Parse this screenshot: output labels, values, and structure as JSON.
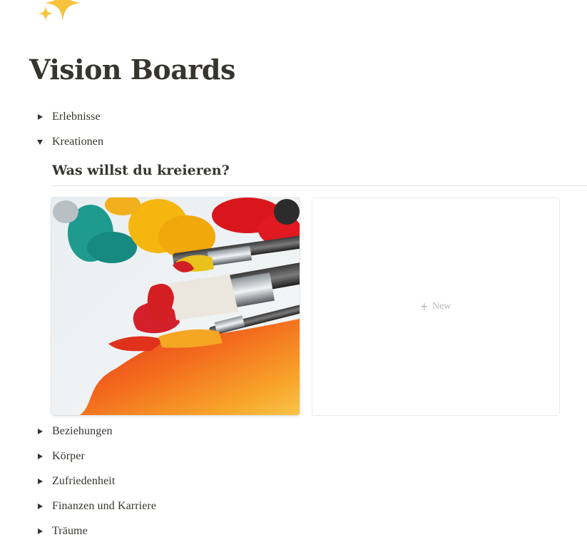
{
  "page": {
    "icon": "sparkles-icon",
    "title": "Vision Boards"
  },
  "toggles_top": [
    {
      "label": "Erlebnisse",
      "expanded": false
    },
    {
      "label": "Kreationen",
      "expanded": true
    }
  ],
  "kreationen": {
    "heading": "Was willst du kreieren?",
    "card_image": "paintbrushes-with-oil-paint",
    "new_label": "New",
    "new_icon": "plus-icon"
  },
  "toggles_bottom": [
    {
      "label": "Beziehungen",
      "expanded": false
    },
    {
      "label": "Körper",
      "expanded": false
    },
    {
      "label": "Zufriedenheit",
      "expanded": false
    },
    {
      "label": "Finanzen und Karriere",
      "expanded": false
    },
    {
      "label": "Träume",
      "expanded": false
    }
  ],
  "colors": {
    "text": "#37352f",
    "muted": "#b9b8b5",
    "divider": "#e3e2e0",
    "sparkle": "#f8c33c"
  }
}
